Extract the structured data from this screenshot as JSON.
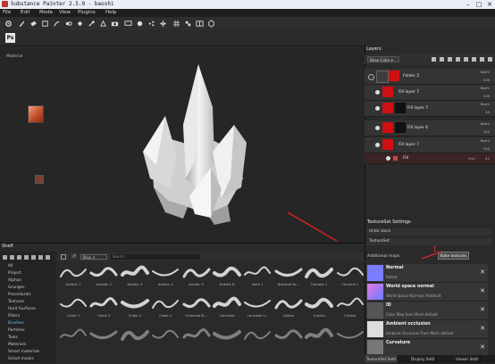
{
  "window": {
    "title": "Substance Painter 2.5.0 - baoshi",
    "min": "–",
    "max": "□",
    "close": "✕"
  },
  "menu": [
    "File",
    "Edit",
    "Mode",
    "View",
    "Plugins",
    "Help"
  ],
  "toolbar_icons": [
    "gear-icon",
    "brush-icon",
    "eraser-icon",
    "projection-icon",
    "smudge-icon",
    "clone-icon",
    "fill-icon",
    "picker-icon",
    "polygon-fill-icon",
    "camera-icon",
    "display-icon",
    "render-icon",
    "share-icon",
    "symmetry-icon",
    "grid-icon",
    "texel-icon",
    "view-mode-icon",
    "camera-mode-icon"
  ],
  "subbar": {
    "ps_label": "Ps"
  },
  "viewport": {
    "label": "Material"
  },
  "layers": {
    "title": "Layers",
    "channel": "Base Color ▾",
    "items": [
      {
        "name": "Folder 2",
        "blend": "Norm",
        "opacity": "100"
      },
      {
        "name": "Fill layer 7",
        "blend": "Norm",
        "opacity": "100"
      },
      {
        "name": "Fill layer 7",
        "blend": "Norm",
        "opacity": "44"
      },
      {
        "name": "Fill layer 6",
        "blend": "Norm",
        "opacity": "100"
      },
      {
        "name": "Fill layer 7",
        "blend": "Norm",
        "opacity": "100"
      }
    ],
    "fill_row": {
      "name": "Fill",
      "blend": "Ovrl",
      "opacity": "41"
    }
  },
  "textureset": {
    "title": "TextureSet Settings",
    "undo": "Undo stack",
    "tset": "TextureSet",
    "additional_maps": "Additional maps",
    "bake_label": "Bake textures",
    "annotation": "1",
    "maps": [
      {
        "name": "Normal",
        "desc": "Baked",
        "color": "#7b7cff"
      },
      {
        "name": "World space normal",
        "desc": "World Space Normals #default",
        "color": "#d37be0"
      },
      {
        "name": "ID",
        "desc": "Color Map from Mesh default",
        "color": "#555555"
      },
      {
        "name": "Ambient occlusion",
        "desc": "Ambient Occlusion from Mesh default",
        "color": "#dddddd"
      },
      {
        "name": "Curvature",
        "desc": "",
        "color": "#777777"
      }
    ],
    "tabs": [
      "TextureSet Setti",
      "Display Setti",
      "Viewer Setti"
    ]
  },
  "shelf": {
    "title": "Shelf",
    "categories": [
      "All",
      "Project",
      "Alphas",
      "Grunges",
      "Procedurals",
      "Textures",
      "Hard Surfaces",
      "Filters",
      "Brushes",
      "Particles",
      "Tools",
      "Materials",
      "Smart materials",
      "Smart masks"
    ],
    "selected_category": "Brushes",
    "filter": "Brus ×",
    "search_placeholder": "Search",
    "brushes_row1": [
      "Artistic 1",
      "Artistic 2",
      "Artistic 3",
      "Artistic 4",
      "Artistic 5",
      "Artistic 6",
      "Bark 1",
      "Basmati Br...",
      "Cement 1",
      "Cement 2"
    ],
    "brushes_row2": [
      "Chalk 1",
      "Chalk 2",
      "Chalk 3",
      "Chalk 4",
      "Charcoal B...",
      "Concrete",
      "Concrete L...",
      "Cotton",
      "Cracks",
      "Crystal"
    ],
    "brushes_row3": [
      "",
      "",
      "",
      "",
      "",
      "",
      "",
      "",
      "",
      ""
    ]
  }
}
